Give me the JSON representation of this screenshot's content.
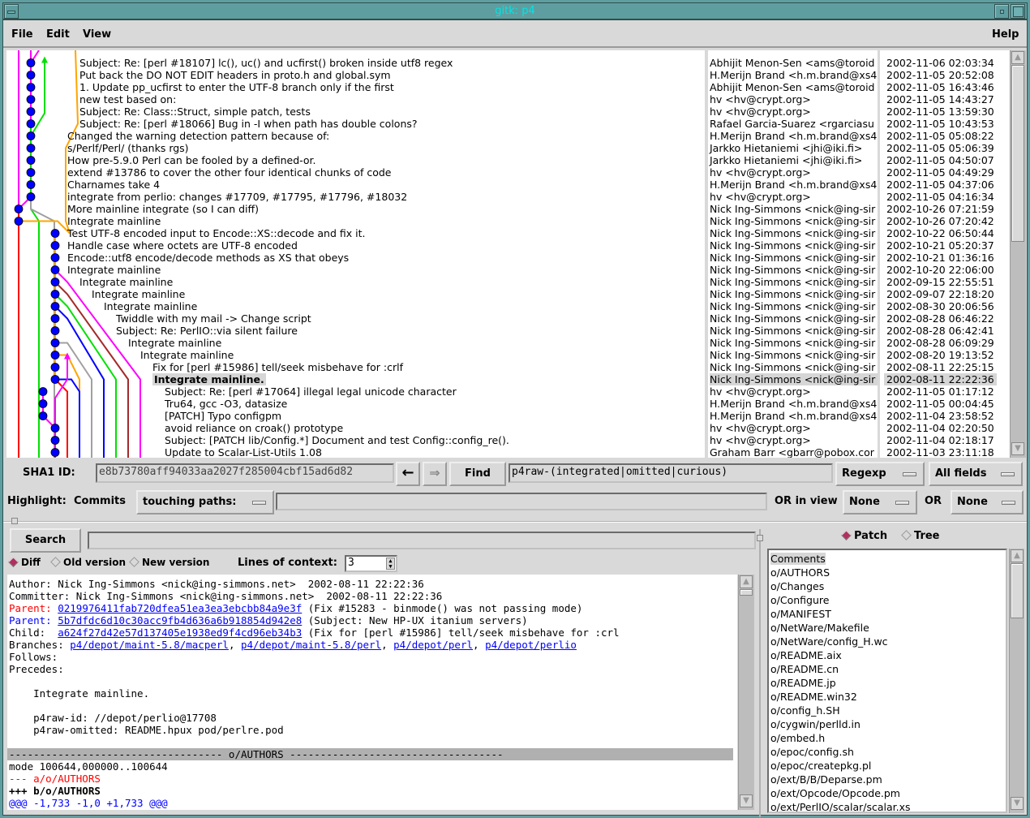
{
  "window": {
    "title": "gitk: p4"
  },
  "menu": {
    "file": "File",
    "edit": "Edit",
    "view": "View",
    "help": "Help"
  },
  "commits": [
    {
      "subject": "Subject: Re: [perl #18107] lc(), uc() and ucfirst() broken inside utf8 regex",
      "author": "Abhijit Menon-Sen <ams@toroid",
      "date": "2002-11-06 02:03:34",
      "indent": 1
    },
    {
      "subject": "Put back the DO NOT EDIT headers in proto.h and global.sym",
      "author": "H.Merijn Brand <h.m.brand@xs4",
      "date": "2002-11-05 20:52:08",
      "indent": 1
    },
    {
      "subject": "1. Update pp_ucfirst to enter the UTF-8 branch only if the first",
      "author": "Abhijit Menon-Sen <ams@toroid",
      "date": "2002-11-05 16:43:46",
      "indent": 1
    },
    {
      "subject": "new test based on:",
      "author": "hv <hv@crypt.org>",
      "date": "2002-11-05 14:43:27",
      "indent": 1
    },
    {
      "subject": "Subject: Re: Class::Struct, simple patch, tests",
      "author": "hv <hv@crypt.org>",
      "date": "2002-11-05 13:59:30",
      "indent": 1
    },
    {
      "subject": "Subject: Re: [perl #18066] Bug in -I when path has double colons?",
      "author": "Rafael Garcia-Suarez <rgarciasu",
      "date": "2002-11-05 10:43:53",
      "indent": 1
    },
    {
      "subject": "Changed the warning detection pattern because of:",
      "author": "H.Merijn Brand <h.m.brand@xs4",
      "date": "2002-11-05 05:08:22",
      "indent": 0
    },
    {
      "subject": "s/Perlf/Perl/ (thanks rgs)",
      "author": "Jarkko Hietaniemi <jhi@iki.fi>",
      "date": "2002-11-05 05:06:39",
      "indent": 0
    },
    {
      "subject": "How pre-5.9.0 Perl can be fooled by a defined-or.",
      "author": "Jarkko Hietaniemi <jhi@iki.fi>",
      "date": "2002-11-05 04:50:07",
      "indent": 0
    },
    {
      "subject": "extend #13786 to cover the other four identical chunks of code",
      "author": "hv <hv@crypt.org>",
      "date": "2002-11-05 04:49:29",
      "indent": 0
    },
    {
      "subject": "Charnames take 4",
      "author": "H.Merijn Brand <h.m.brand@xs4",
      "date": "2002-11-05 04:37:06",
      "indent": 0
    },
    {
      "subject": "integrate from perlio: changes #17709, #17795, #17796, #18032",
      "author": "hv <hv@crypt.org>",
      "date": "2002-11-05 04:16:34",
      "indent": 0
    },
    {
      "subject": "More mainline integrate (so I can diff)",
      "author": "Nick Ing-Simmons <nick@ing-sir",
      "date": "2002-10-26 07:21:59",
      "indent": 0
    },
    {
      "subject": "Integrate mainline",
      "author": "Nick Ing-Simmons <nick@ing-sir",
      "date": "2002-10-26 07:20:42",
      "indent": 0
    },
    {
      "subject": "Test UTF-8 encoded input to Encode::XS::decode and fix it.",
      "author": "Nick Ing-Simmons <nick@ing-sir",
      "date": "2002-10-22 06:50:44",
      "indent": 0
    },
    {
      "subject": "Handle case where octets are UTF-8 encoded",
      "author": "Nick Ing-Simmons <nick@ing-sir",
      "date": "2002-10-21 05:20:37",
      "indent": 0
    },
    {
      "subject": "Encode::utf8 encode/decode methods as XS that obeys",
      "author": "Nick Ing-Simmons <nick@ing-sir",
      "date": "2002-10-21 01:36:16",
      "indent": 0
    },
    {
      "subject": "Integrate mainline",
      "author": "Nick Ing-Simmons <nick@ing-sir",
      "date": "2002-10-20 22:06:00",
      "indent": 0
    },
    {
      "subject": "Integrate mainline",
      "author": "Nick Ing-Simmons <nick@ing-sir",
      "date": "2002-09-15 22:55:51",
      "indent": 1
    },
    {
      "subject": "Integrate mainline",
      "author": "Nick Ing-Simmons <nick@ing-sir",
      "date": "2002-09-07 22:18:20",
      "indent": 2
    },
    {
      "subject": "Integrate mainline",
      "author": "Nick Ing-Simmons <nick@ing-sir",
      "date": "2002-08-30 20:06:56",
      "indent": 3
    },
    {
      "subject": "Twiddle with my mail -> Change script",
      "author": "Nick Ing-Simmons <nick@ing-sir",
      "date": "2002-08-28 06:46:22",
      "indent": 4
    },
    {
      "subject": "Subject:  Re: PerlIO::via silent failure",
      "author": "Nick Ing-Simmons <nick@ing-sir",
      "date": "2002-08-28 06:42:41",
      "indent": 4
    },
    {
      "subject": "Integrate mainline",
      "author": "Nick Ing-Simmons <nick@ing-sir",
      "date": "2002-08-28 06:09:29",
      "indent": 5
    },
    {
      "subject": "Integrate mainline",
      "author": "Nick Ing-Simmons <nick@ing-sir",
      "date": "2002-08-20 19:13:52",
      "indent": 6
    },
    {
      "subject": "Fix for [perl #15986] tell/seek misbehave for :crlf",
      "author": "Nick Ing-Simmons <nick@ing-sir",
      "date": "2002-08-11 22:25:15",
      "indent": 7
    },
    {
      "subject": "Integrate mainline.",
      "author": "Nick Ing-Simmons <nick@ing-sir",
      "date": "2002-08-11 22:22:36",
      "indent": 7,
      "selected": true
    },
    {
      "subject": "Subject: Re: [perl #17064] illegal legal unicode character",
      "author": "hv <hv@crypt.org>",
      "date": "2002-11-05 01:17:12",
      "indent": 8
    },
    {
      "subject": "Tru64, gcc -O3, datasize",
      "author": "H.Merijn Brand <h.m.brand@xs4",
      "date": "2002-11-05 00:04:45",
      "indent": 8
    },
    {
      "subject": "[PATCH] Typo configpm",
      "author": "H.Merijn Brand <h.m.brand@xs4",
      "date": "2002-11-04 23:58:52",
      "indent": 8
    },
    {
      "subject": "avoid reliance on croak() prototype",
      "author": "hv <hv@crypt.org>",
      "date": "2002-11-04 02:20:50",
      "indent": 8
    },
    {
      "subject": "Subject: [PATCH lib/Config.*] Document and test Config::config_re().",
      "author": "hv <hv@crypt.org>",
      "date": "2002-11-04 02:18:17",
      "indent": 8
    },
    {
      "subject": "Update to Scalar-List-Utils 1.08",
      "author": "Graham Barr <gbarr@pobox.cor",
      "date": "2002-11-03 23:11:18",
      "indent": 8
    }
  ],
  "toolbar": {
    "sha1_label": "SHA1 ID:",
    "sha1_value": "e8b73780aff94033aa2027f285004cbf15ad6d82",
    "back_icon": "left-arrow",
    "forward_icon": "right-arrow",
    "find_label": "Find",
    "find_value": "p4raw-(integrated|omitted|curious)",
    "find_type": "Regexp",
    "find_fields": "All fields"
  },
  "highlight": {
    "label": "Highlight:",
    "commits_label": "Commits",
    "mode": "touching paths:",
    "paths_value": "",
    "or_in_view_label": "OR in view",
    "or_in_view_value": "None",
    "or_label": "OR",
    "or_value": "None"
  },
  "search": {
    "button": "Search",
    "value": ""
  },
  "diff_options": {
    "diff": "Diff",
    "old_version": "Old version",
    "new_version": "New version",
    "selected": "Diff",
    "context_label": "Lines of context:",
    "context_value": "3"
  },
  "details": {
    "author": "Author: Nick Ing-Simmons <nick@ing-simmons.net>  2002-08-11 22:22:36",
    "committer": "Committer: Nick Ing-Simmons <nick@ing-simmons.net>  2002-08-11 22:22:36",
    "parent1_label": "Parent: ",
    "parent1_sha": "0219976411fab720dfea51ea3ea3ebcbb84a9e3f",
    "parent1_desc": " (Fix #15283 - binmode() was not passing mode)",
    "parent2_label": "Parent: ",
    "parent2_sha": "5b7dfdc6d10c30acc9fb4d636a6b918854d942e8",
    "parent2_desc": " (Subject: New HP-UX itanium servers)",
    "child_label": "Child:  ",
    "child_sha": "a624f27d42e57d137405e1938ed9f4cd96eb34b3",
    "child_desc": " (Fix for [perl #15986] tell/seek misbehave for :crl",
    "branches_label": "Branches: ",
    "branches": [
      "p4/depot/maint-5.8/macperl",
      "p4/depot/maint-5.8/perl",
      "p4/depot/perl",
      "p4/depot/perlio"
    ],
    "follows": "Follows:",
    "precedes": "Precedes:",
    "message": [
      "    Integrate mainline.",
      "",
      "    p4raw-id: //depot/perlio@17708",
      "    p4raw-omitted: README.hpux pod/perlre.pod"
    ],
    "file_header": "----------------------------------- o/AUTHORS -----------------------------------",
    "mode_line": "mode 100644,000000..100644",
    "minus_line": "--- a/o/AUTHORS",
    "plus_line": "+++ b/o/AUTHORS",
    "hunk_line": "@@@ -1,733 -1,0 +1,733 @@@"
  },
  "file_view": {
    "patch": "Patch",
    "tree": "Tree",
    "selected": "Patch"
  },
  "files": [
    "Comments",
    "o/AUTHORS",
    "o/Changes",
    "o/Configure",
    "o/MANIFEST",
    "o/NetWare/Makefile",
    "o/NetWare/config_H.wc",
    "o/README.aix",
    "o/README.cn",
    "o/README.jp",
    "o/README.win32",
    "o/config_h.SH",
    "o/cygwin/perlld.in",
    "o/embed.h",
    "o/epoc/config.sh",
    "o/epoc/createpkg.pl",
    "o/ext/B/B/Deparse.pm",
    "o/ext/Opcode/Opcode.pm",
    "o/ext/PerlIO/scalar/scalar.xs"
  ],
  "colors": {
    "node": "#0000ff",
    "parent_label": "#ff0000",
    "link": "#0000ff",
    "diff_minus": "#ff0000",
    "hunk": "#0000ff",
    "radio_on": "#b03060"
  }
}
